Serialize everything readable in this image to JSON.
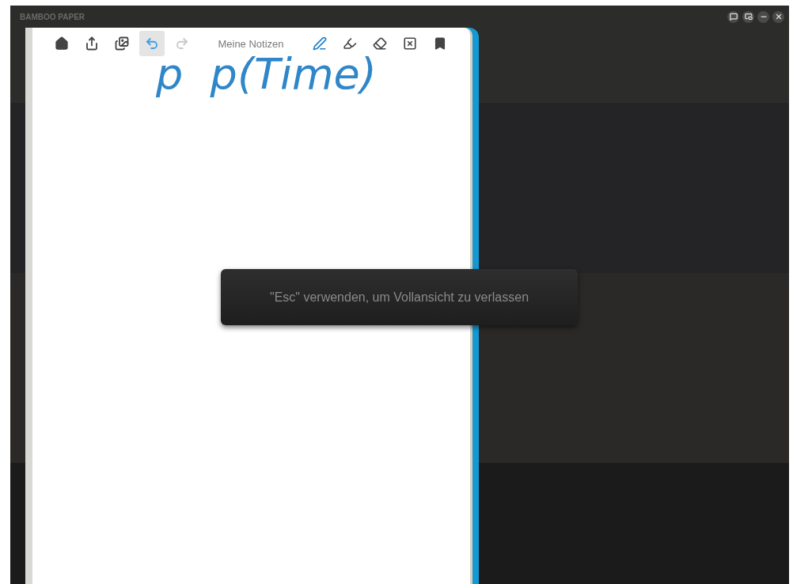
{
  "window": {
    "title": "BAMBOO PAPER"
  },
  "notebook": {
    "title": "Meine Notizen",
    "left_tools": [
      {
        "selected": false,
        "disabled": false
      },
      {
        "selected": false,
        "disabled": false
      },
      {
        "selected": false,
        "disabled": false
      },
      {
        "selected": true,
        "disabled": false
      },
      {
        "selected": false,
        "disabled": true
      }
    ],
    "right_tools": [
      {
        "selected": true
      },
      {
        "selected": false
      },
      {
        "selected": false
      },
      {
        "selected": false
      },
      {
        "selected": false
      }
    ],
    "ink": "p  p(Time)"
  },
  "toast": {
    "message": "\"Esc\" verwenden, um Vollansicht zu verlassen"
  }
}
